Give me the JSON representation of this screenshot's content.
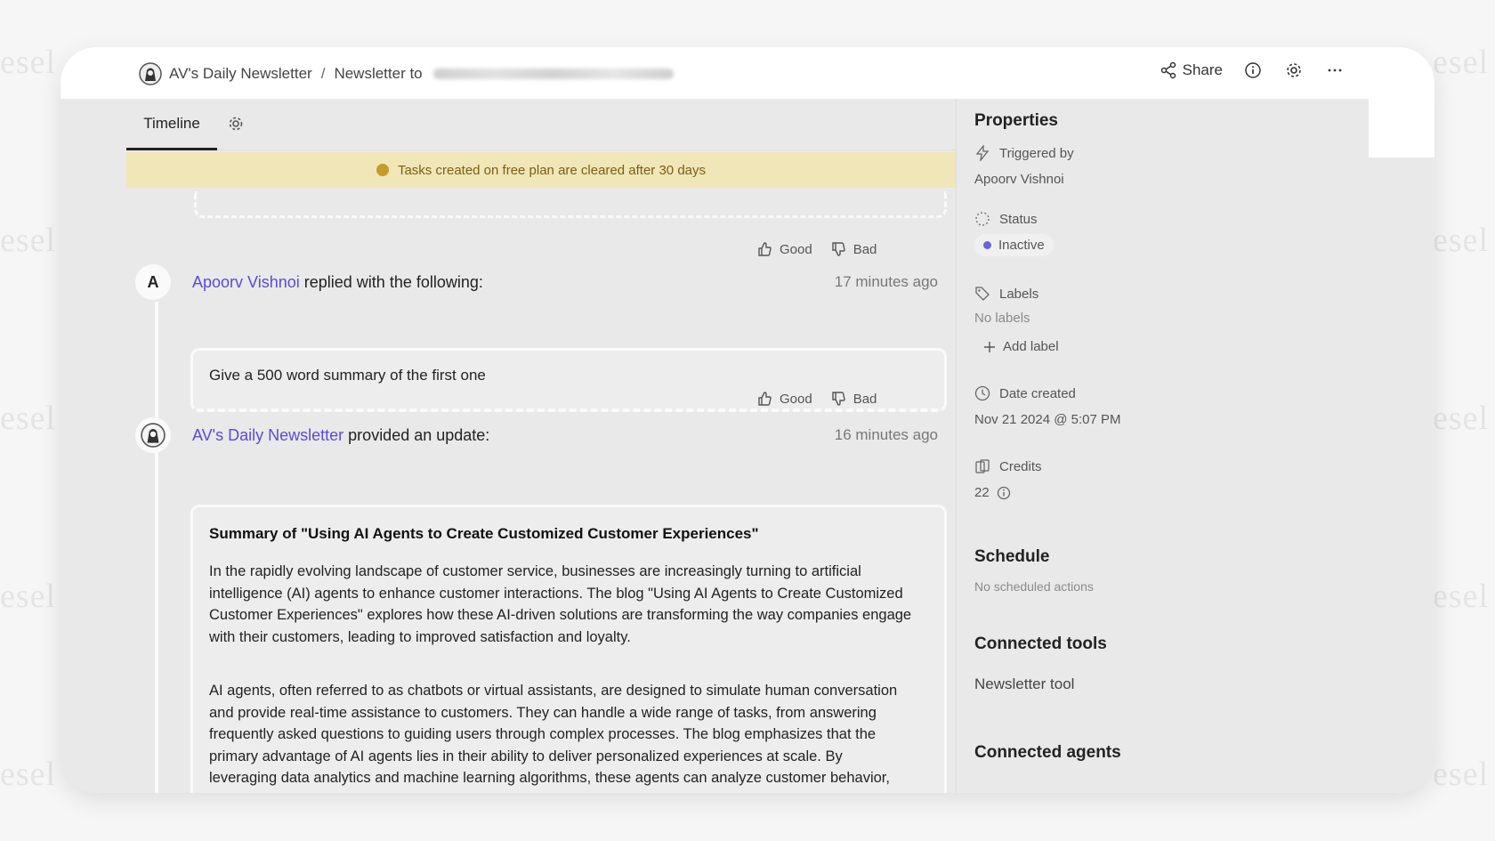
{
  "watermark": "esel",
  "breadcrumb": {
    "agent_name": "AV's Daily Newsletter",
    "separator": "/",
    "page": "Newsletter to"
  },
  "top_actions": {
    "share_label": "Share",
    "icons": [
      "share-icon",
      "info-icon",
      "gear-icon",
      "more-icon"
    ]
  },
  "tabs": [
    {
      "label": "Timeline",
      "active": true
    }
  ],
  "banner": "Tasks created on free plan are cleared after 30 days",
  "feedback": {
    "good": "Good",
    "bad": "Bad"
  },
  "messages": [
    {
      "avatar": "A",
      "author": "Apoorv Vishnoi",
      "action": "replied with the following:",
      "time": "17 minutes ago",
      "body": "Give a 500 word summary of the first one"
    },
    {
      "avatar": "agent-icon",
      "author": "AV's Daily Newsletter",
      "action": "provided an update:",
      "time": "16 minutes ago",
      "title": "Summary of \"Using AI Agents to Create Customized Customer Experiences\"",
      "paragraphs": [
        "In the rapidly evolving landscape of customer service, businesses are increasingly turning to artificial intelligence (AI) agents to enhance customer interactions. The blog \"Using AI Agents to Create Customized Customer Experiences\" explores how these AI-driven solutions are transforming the way companies engage with their customers, leading to improved satisfaction and loyalty.",
        "AI agents, often referred to as chatbots or virtual assistants, are designed to simulate human conversation and provide real-time assistance to customers. They can handle a wide range of tasks, from answering frequently asked questions to guiding users through complex processes. The blog emphasizes that the primary advantage of AI agents lies in their ability to deliver personalized experiences at scale. By leveraging data analytics and machine learning algorithms, these agents can analyze customer behavior, preferences, and past interactions to tailor responses and recommendations."
      ]
    }
  ],
  "properties": {
    "title": "Properties",
    "triggered_by_label": "Triggered by",
    "triggered_by_value": "Apoorv Vishnoi",
    "status_label": "Status",
    "status_value": "Inactive",
    "labels_label": "Labels",
    "labels_value": "No labels",
    "add_label": "Add label",
    "date_label": "Date created",
    "date_value": "Nov 21 2024 @ 5:07 PM",
    "credits_label": "Credits",
    "credits_value": "22"
  },
  "schedule": {
    "title": "Schedule",
    "value": "No scheduled actions"
  },
  "connected_tools": {
    "title": "Connected tools",
    "items": [
      "Newsletter tool"
    ]
  },
  "connected_agents": {
    "title": "Connected agents"
  },
  "colors": {
    "accent": "#5b4bd6",
    "banner_bg": "#f1e6b8",
    "banner_text": "#7b5e16",
    "status_dot": "#6b63d9"
  }
}
